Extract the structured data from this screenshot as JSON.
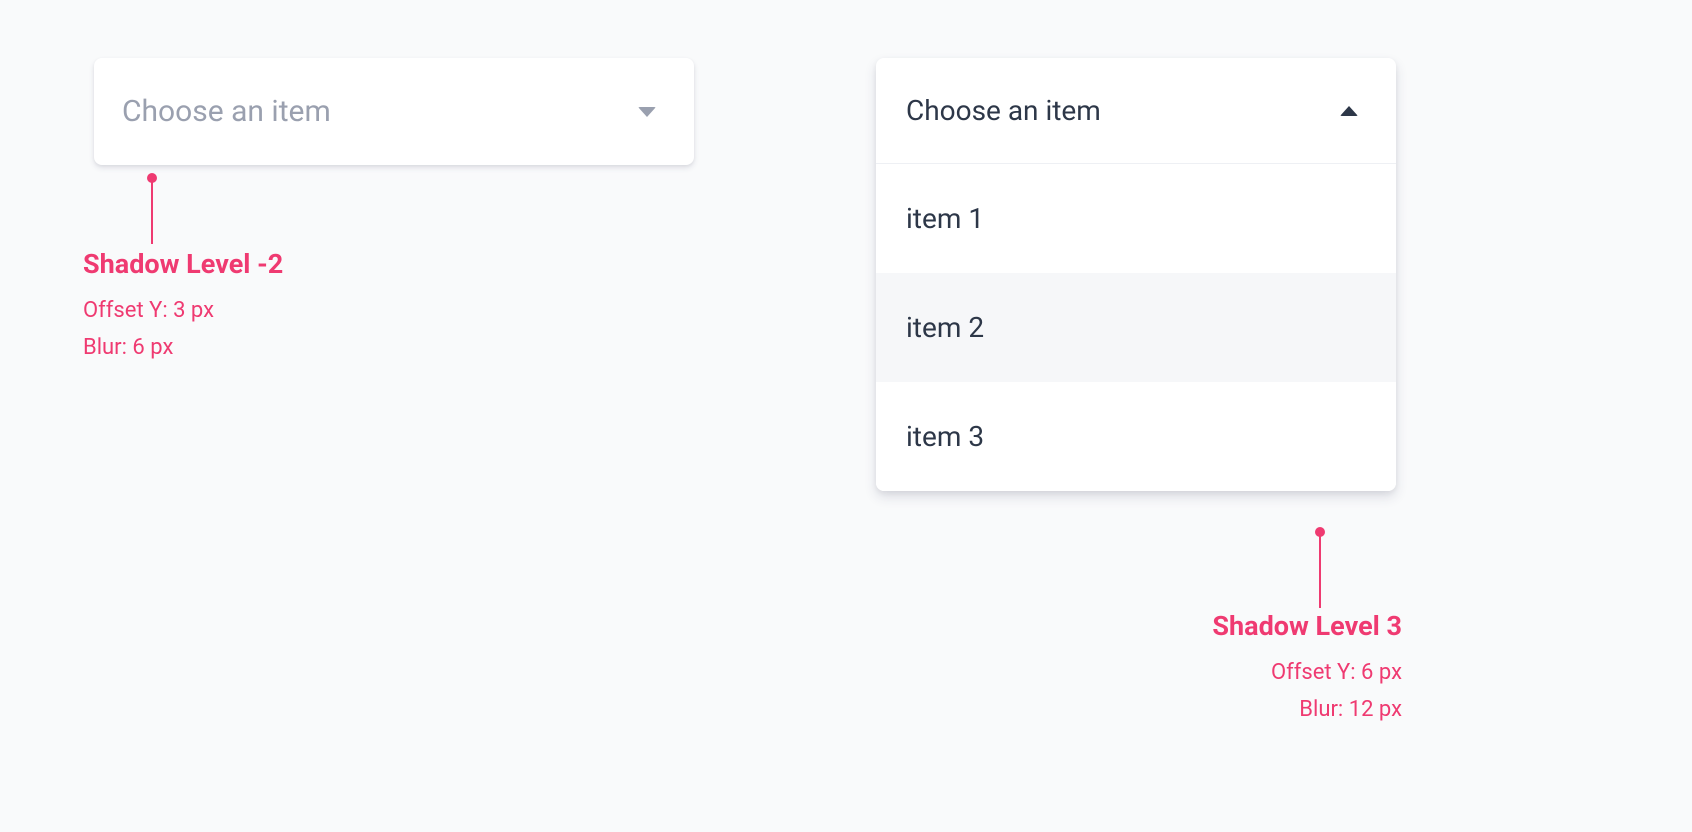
{
  "dropdown_closed": {
    "placeholder": "Choose an item"
  },
  "dropdown_open": {
    "header": "Choose an item",
    "items": [
      "item 1",
      "item 2",
      "item 3"
    ]
  },
  "annotations": {
    "left": {
      "title": "Shadow Level -2",
      "offset": "Offset Y: 3 px",
      "blur": "Blur: 6 px"
    },
    "right": {
      "title": "Shadow Level 3",
      "offset": "Offset Y: 6 px",
      "blur": "Blur: 12 px"
    }
  }
}
